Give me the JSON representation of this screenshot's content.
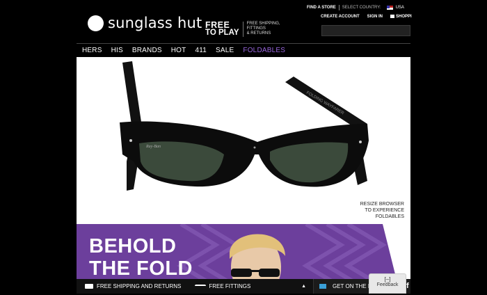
{
  "header": {
    "logo_text": "sunglass hut",
    "promo": {
      "line1": "FREE",
      "line2": "TO PLAY",
      "detail1": "FREE SHIPPING,",
      "detail2": "FITTINGS",
      "detail3": "& RETURNS"
    },
    "utility": {
      "find_store": "FIND A STORE",
      "select_country": "SELECT COUNTRY:",
      "country": "USA"
    },
    "account": {
      "create_account": "CREATE ACCOUNT",
      "sign_in": "SIGN IN",
      "shopping": "SHOPPI"
    },
    "search": {
      "placeholder": ""
    }
  },
  "nav": {
    "items": [
      "HERS",
      "HIS",
      "BRANDS",
      "HOT",
      "411",
      "SALE",
      "FOLDABLES"
    ],
    "active_index": 6,
    "active_color": "#9966dd"
  },
  "hero": {
    "brand_mark": "Ray-Ban",
    "temple_text": "FOLDING WAYFARER",
    "resize_l1": "RESIZE BROWSER",
    "resize_l2": "TO EXPERIENCE",
    "resize_l3": "FOLDABLES"
  },
  "banner": {
    "line1": "BEHOLD",
    "line2": "THE FOLD",
    "bg_color": "#6c3f9c"
  },
  "footer": {
    "shipping": "FREE SHIPPING AND RETURNS",
    "fittings": "FREE FITTINGS",
    "list": "GET ON THE LIST",
    "caret": "▲"
  },
  "feedback": {
    "icon": "[–]",
    "label": "Feedback"
  },
  "social": {
    "letter": "f"
  }
}
